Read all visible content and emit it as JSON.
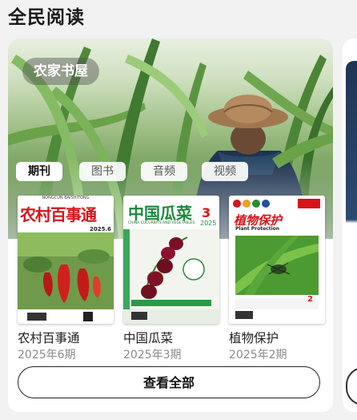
{
  "section": {
    "title": "全民阅读"
  },
  "hero": {
    "badge": "农家书屋"
  },
  "tabs": [
    {
      "label": "期刊",
      "active": true
    },
    {
      "label": "图书",
      "active": false
    },
    {
      "label": "音频",
      "active": false
    },
    {
      "label": "视频",
      "active": false
    }
  ],
  "books": [
    {
      "title": "农村百事通",
      "issue": "2025年6期",
      "cover_title": "农村百事通",
      "cover_topline": "NONGCUN BAISHITONG",
      "cover_issue": "2025.6"
    },
    {
      "title": "中国瓜菜",
      "issue": "2025年3期",
      "cover_title": "中国瓜菜",
      "cover_subtitle": "CHINA CUCURBITS AND VEGETABLES",
      "cover_year": "2025",
      "cover_number": "3"
    },
    {
      "title": "植物保护",
      "issue": "2025年2期",
      "cover_title": "植物保护",
      "cover_subtitle": "Plant Protection",
      "cover_number": "2"
    }
  ],
  "view_all": {
    "label": "查看全部"
  },
  "colors": {
    "accent_red": "#d7141a",
    "accent_green": "#1a8a3a",
    "text_dark": "#222222",
    "text_muted": "#8a8a8a"
  }
}
